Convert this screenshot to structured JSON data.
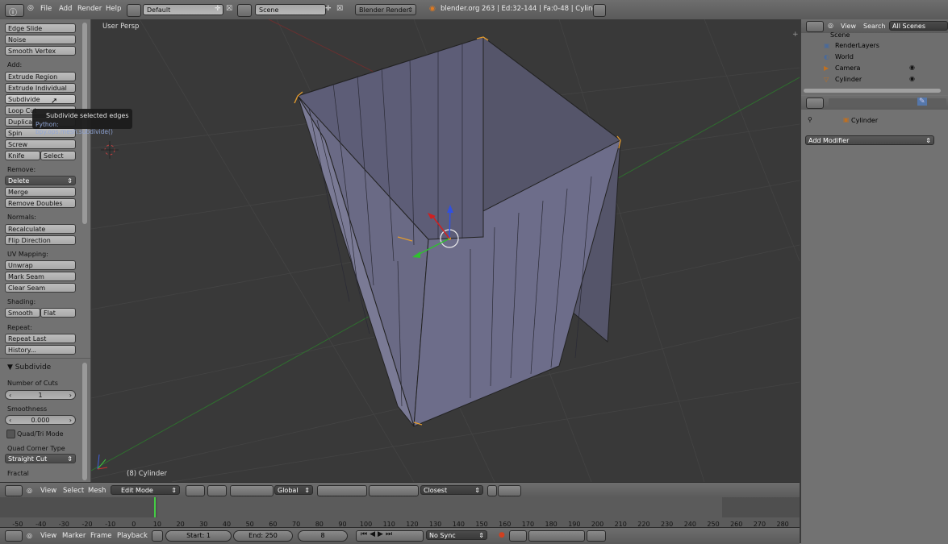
{
  "top_header": {
    "menus": [
      "File",
      "Add",
      "Render",
      "Help"
    ],
    "screen_layout": "Default",
    "scene": "Scene",
    "render_engine": "Blender Render",
    "stats": "blender.org 263 | Ed:32-144 | Fa:0-48 | Cylinder"
  },
  "tool_shelf": {
    "items_top": [
      "Edge Slide",
      "Noise",
      "Smooth Vertex"
    ],
    "add_label": "Add:",
    "add_items": [
      "Extrude Region",
      "Extrude Individual",
      "Subdivide",
      "Loop Cut",
      "Duplicate",
      "Spin",
      "Screw"
    ],
    "knife": "Knife",
    "select": "Select",
    "remove_label": "Remove:",
    "delete": "Delete",
    "merge": "Merge",
    "remove_doubles": "Remove Doubles",
    "normals_label": "Normals:",
    "recalculate": "Recalculate",
    "flip_direction": "Flip Direction",
    "uv_label": "UV Mapping:",
    "unwrap": "Unwrap",
    "mark_seam": "Mark Seam",
    "clear_seam": "Clear Seam",
    "shading_label": "Shading:",
    "smooth": "Smooth",
    "flat": "Flat",
    "repeat_label": "Repeat:",
    "repeat_last": "Repeat Last",
    "history": "History..."
  },
  "operator_panel": {
    "title": "Subdivide",
    "cuts_label": "Number of Cuts",
    "cuts_value": "1",
    "smoothness_label": "Smoothness",
    "smoothness_value": "0.000",
    "quad_tri": "Quad/Tri Mode",
    "corner_label": "Quad Corner Type",
    "corner_value": "Straight Cut",
    "fractal_label": "Fractal"
  },
  "tooltip": {
    "title": "Subdivide selected edges",
    "python": "Python: bpy.ops.mesh.subdivide()"
  },
  "viewport": {
    "view_name": "User Persp",
    "object_label": "(8) Cylinder"
  },
  "view3d_header": {
    "menus": [
      "View",
      "Select",
      "Mesh"
    ],
    "mode": "Edit Mode",
    "orientation": "Global",
    "snap_target": "Closest"
  },
  "outliner": {
    "view": "View",
    "search": "Search",
    "filter": "All Scenes",
    "items": [
      "Scene",
      "RenderLayers",
      "World",
      "Camera",
      "Cylinder"
    ]
  },
  "properties": {
    "object_name": "Cylinder",
    "add_modifier": "Add Modifier"
  },
  "timeline": {
    "ticks": [
      "-50",
      "-40",
      "-30",
      "-20",
      "-10",
      "0",
      "10",
      "20",
      "30",
      "40",
      "50",
      "60",
      "70",
      "80",
      "90",
      "100",
      "110",
      "120",
      "130",
      "140",
      "150",
      "160",
      "170",
      "180",
      "190",
      "200",
      "210",
      "220",
      "230",
      "240",
      "250",
      "260",
      "270",
      "280"
    ],
    "menus": [
      "View",
      "Marker",
      "Frame",
      "Playback"
    ],
    "start": "Start: 1",
    "end": "End: 250",
    "current": "8",
    "sync": "No Sync"
  }
}
